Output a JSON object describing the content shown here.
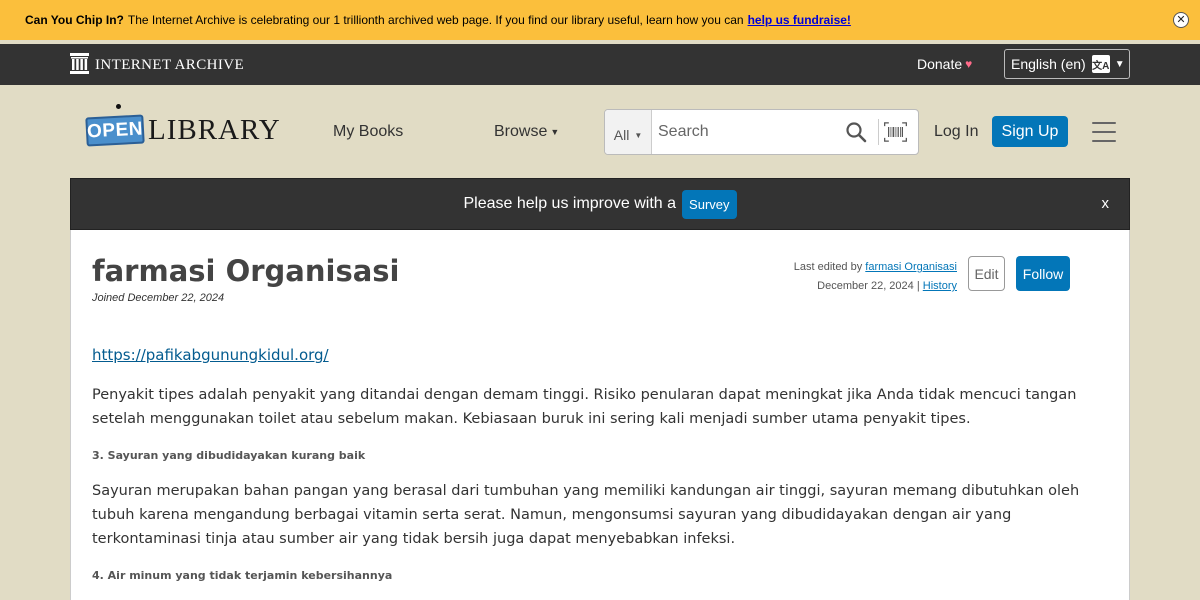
{
  "donation_banner": {
    "lead": "Can You Chip In?",
    "message": "The Internet Archive is celebrating our 1 trillionth archived web page. If you find our library useful, learn how you can",
    "link_text": "help us fundraise!",
    "close_label": "✕"
  },
  "ia_bar": {
    "logo_text": "INTERNET ARCHIVE",
    "donate_label": "Donate",
    "language_label": "English (en)"
  },
  "header": {
    "logo_open": "OPEN",
    "logo_library": "LIBRARY",
    "my_books": "My Books",
    "browse": "Browse",
    "search_scope": "All",
    "search_placeholder": "Search",
    "login": "Log In",
    "signup": "Sign Up"
  },
  "survey": {
    "text": "Please help us improve with a",
    "button": "Survey",
    "close": "x"
  },
  "profile": {
    "name": "farmasi Organisasi",
    "joined": "Joined December 22, 2024",
    "last_edited_prefix": "Last edited by",
    "last_edited_by": "farmasi Organisasi",
    "last_edited_date": "December 22, 2024",
    "history_separator": "|",
    "history_link": "History",
    "edit_button": "Edit",
    "follow_button": "Follow",
    "website": "https://pafikabgunungkidul.org/",
    "paragraph_1": "Penyakit tipes adalah penyakit yang ditandai dengan demam tinggi. Risiko penularan dapat meningkat jika Anda tidak mencuci tangan setelah menggunakan toilet atau sebelum makan. Kebiasaan buruk ini sering kali menjadi sumber utama penyakit tipes.",
    "subheading_3": "3. Sayuran yang dibudidayakan kurang baik",
    "paragraph_2": "Sayuran merupakan bahan pangan yang berasal dari tumbuhan yang memiliki kandungan air tinggi, sayuran memang dibutuhkan oleh tubuh karena mengandung berbagai vitamin serta serat. Namun, mengonsumsi sayuran yang dibudidayakan dengan air yang terkontaminasi tinja atau sumber air yang tidak bersih juga dapat menyebabkan infeksi.",
    "subheading_4": "4. Air minum yang tidak terjamin kebersihannya"
  },
  "colors": {
    "donation_banner_bg": "#fbbf3c",
    "ia_bar_bg": "#333333",
    "page_bg": "#e1dcc5",
    "primary_button": "#0376b8"
  },
  "icons": {
    "ia_logo": "internet-archive-building-icon",
    "heart": "heart-icon",
    "language": "translate-icon",
    "search": "search-icon",
    "barcode": "barcode-scanner-icon",
    "menu": "hamburger-menu-icon"
  }
}
